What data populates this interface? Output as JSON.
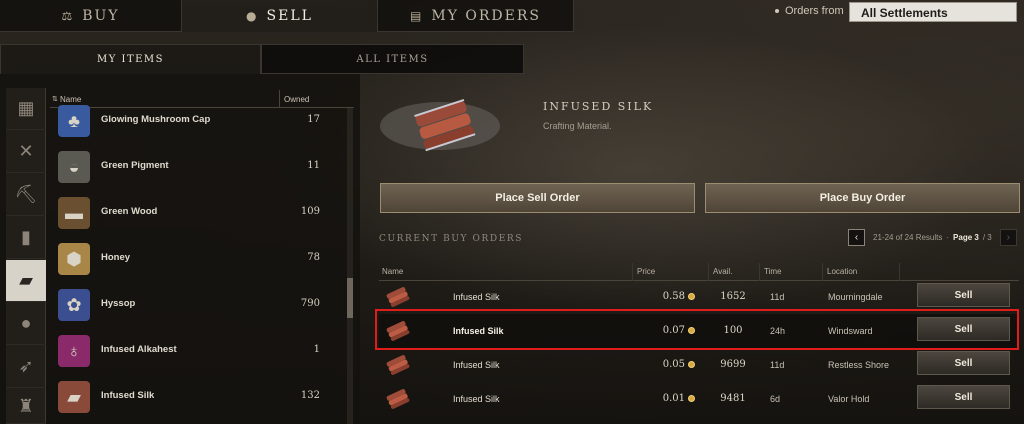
{
  "topnav": {
    "tabs": [
      {
        "label": "BUY",
        "icon": "balance-scale-icon"
      },
      {
        "label": "SELL",
        "icon": "coins-icon"
      },
      {
        "label": "MY ORDERS",
        "icon": "clipboard-icon"
      }
    ],
    "orders_from_label": "Orders from",
    "settlements_value": "All Settlements"
  },
  "subtabs": [
    "MY ITEMS",
    "ALL ITEMS"
  ],
  "categories": [
    "grid-icon",
    "crossed-swords-icon",
    "pickaxe-icon",
    "armor-icon",
    "cloth-bolt-icon",
    "pouch-icon",
    "arrow-icon",
    "chair-icon"
  ],
  "item_list": {
    "headers": {
      "name": "Name",
      "owned": "Owned"
    },
    "items": [
      {
        "name": "Glowing Mushroom Cap",
        "owned": "17",
        "icon": "mushroom-icon",
        "color": "#3a5aa0"
      },
      {
        "name": "Green Pigment",
        "owned": "11",
        "icon": "pigment-bowl-icon",
        "color": "#5a5a52"
      },
      {
        "name": "Green Wood",
        "owned": "109",
        "icon": "wood-log-icon",
        "color": "#6a5030"
      },
      {
        "name": "Honey",
        "owned": "78",
        "icon": "honeycomb-icon",
        "color": "#a88648"
      },
      {
        "name": "Hyssop",
        "owned": "790",
        "icon": "flower-icon",
        "color": "#3b4f90"
      },
      {
        "name": "Infused Alkahest",
        "owned": "1",
        "icon": "potion-icon",
        "color": "#8a2a6a"
      },
      {
        "name": "Infused Silk",
        "owned": "132",
        "icon": "silk-bolt-icon",
        "color": "#8a4a3a"
      }
    ]
  },
  "detail": {
    "title": "INFUSED SILK",
    "subtitle": "Crafting Material.",
    "place_sell_label": "Place Sell Order",
    "place_buy_label": "Place Buy Order"
  },
  "buy_orders": {
    "section_title": "CURRENT BUY ORDERS",
    "results_text": "21-24 of 24 Results",
    "page_label": "Page 3",
    "page_total": "/ 3",
    "headers": {
      "name": "Name",
      "price": "Price",
      "avail": "Avail.",
      "time": "Time",
      "location": "Location"
    },
    "rows": [
      {
        "name": "Infused Silk",
        "price": "0.58",
        "avail": "1652",
        "time": "11d",
        "location": "Mourningdale",
        "action": "Sell"
      },
      {
        "name": "Infused Silk",
        "price": "0.07",
        "avail": "100",
        "time": "24h",
        "location": "Windsward",
        "action": "Sell"
      },
      {
        "name": "Infused Silk",
        "price": "0.05",
        "avail": "9699",
        "time": "11d",
        "location": "Restless Shore",
        "action": "Sell"
      },
      {
        "name": "Infused Silk",
        "price": "0.01",
        "avail": "9481",
        "time": "6d",
        "location": "Valor Hold",
        "action": "Sell"
      }
    ]
  }
}
